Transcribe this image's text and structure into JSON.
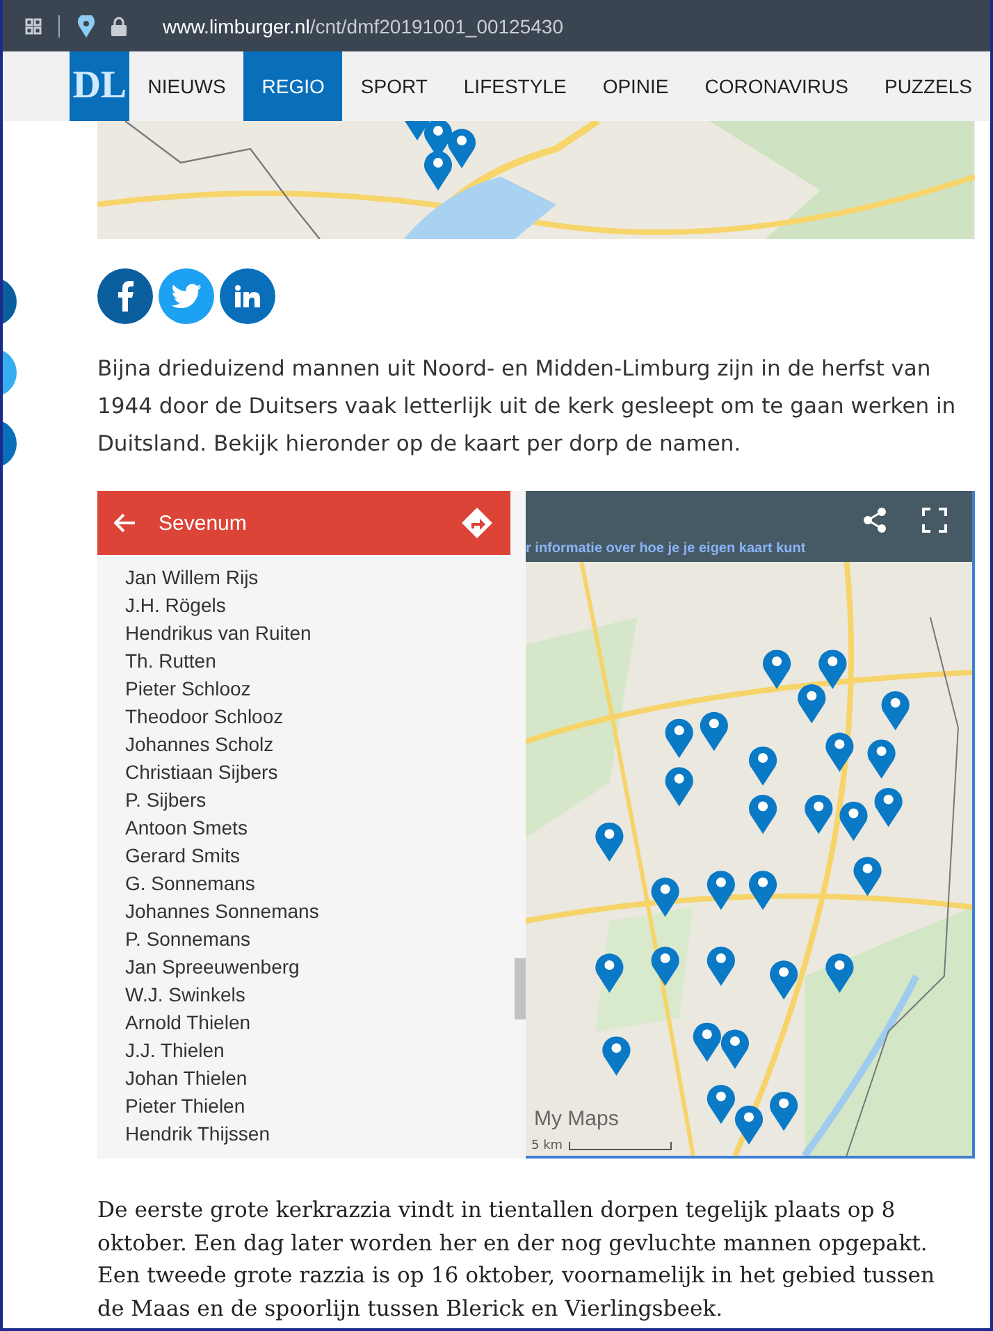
{
  "browser": {
    "url_host": "www.limburger.nl",
    "url_path": "/cnt/dmf20191001_00125430"
  },
  "site_nav": {
    "logo": "DL",
    "items": [
      {
        "label": "NIEUWS",
        "selected": false
      },
      {
        "label": "REGIO",
        "selected": true
      },
      {
        "label": "SPORT",
        "selected": false
      },
      {
        "label": "LIFESTYLE",
        "selected": false
      },
      {
        "label": "OPINIE",
        "selected": false
      },
      {
        "label": "CORONAVIRUS",
        "selected": false
      },
      {
        "label": "PUZZELS",
        "selected": false
      }
    ]
  },
  "share_buttons": [
    {
      "kind": "facebook"
    },
    {
      "kind": "twitter"
    },
    {
      "kind": "linkedin"
    }
  ],
  "intro": "Bijna drieduizend mannen uit Noord- en Midden-Limburg zijn in de herfst van 1944 door de Duitsers vaak letterlijk uit de kerk gesleept om te gaan werken in Duitsland. Bekijk hieronder op de kaart per dorp de namen.",
  "embedded_map": {
    "panel_title": "Sevenum",
    "names": [
      "Jan Willem Rijs",
      "J.H. Rögels",
      "Hendrikus van Ruiten",
      "Th. Rutten",
      "Pieter Schlooz",
      "Theodoor Schlooz",
      "Johannes Scholz",
      "Christiaan Sijbers",
      "P. Sijbers",
      "Antoon Smets",
      "Gerard Smits",
      "G. Sonnemans",
      "Johannes Sonnemans",
      "P. Sonnemans",
      "Jan Spreeuwenberg",
      "W.J. Swinkels",
      "Arnold Thielen",
      "J.J. Thielen",
      "Johan Thielen",
      "Pieter Thielen",
      "Hendrik Thijssen"
    ],
    "header_link": "r informatie over hoe je je eigen kaart kunt",
    "brand": "My Maps",
    "scale": "5 km"
  },
  "body": "De eerste grote kerkrazzia vindt in tientallen dorpen tegelijk plaats op 8 oktober. Een dag later worden her en der nog gevluchte mannen opgepakt. Een tweede grote razzia is op 16 oktober, voornamelijk in het gebied tussen de Maas en de spoorlijn tussen Blerick en Vierlingsbeek."
}
